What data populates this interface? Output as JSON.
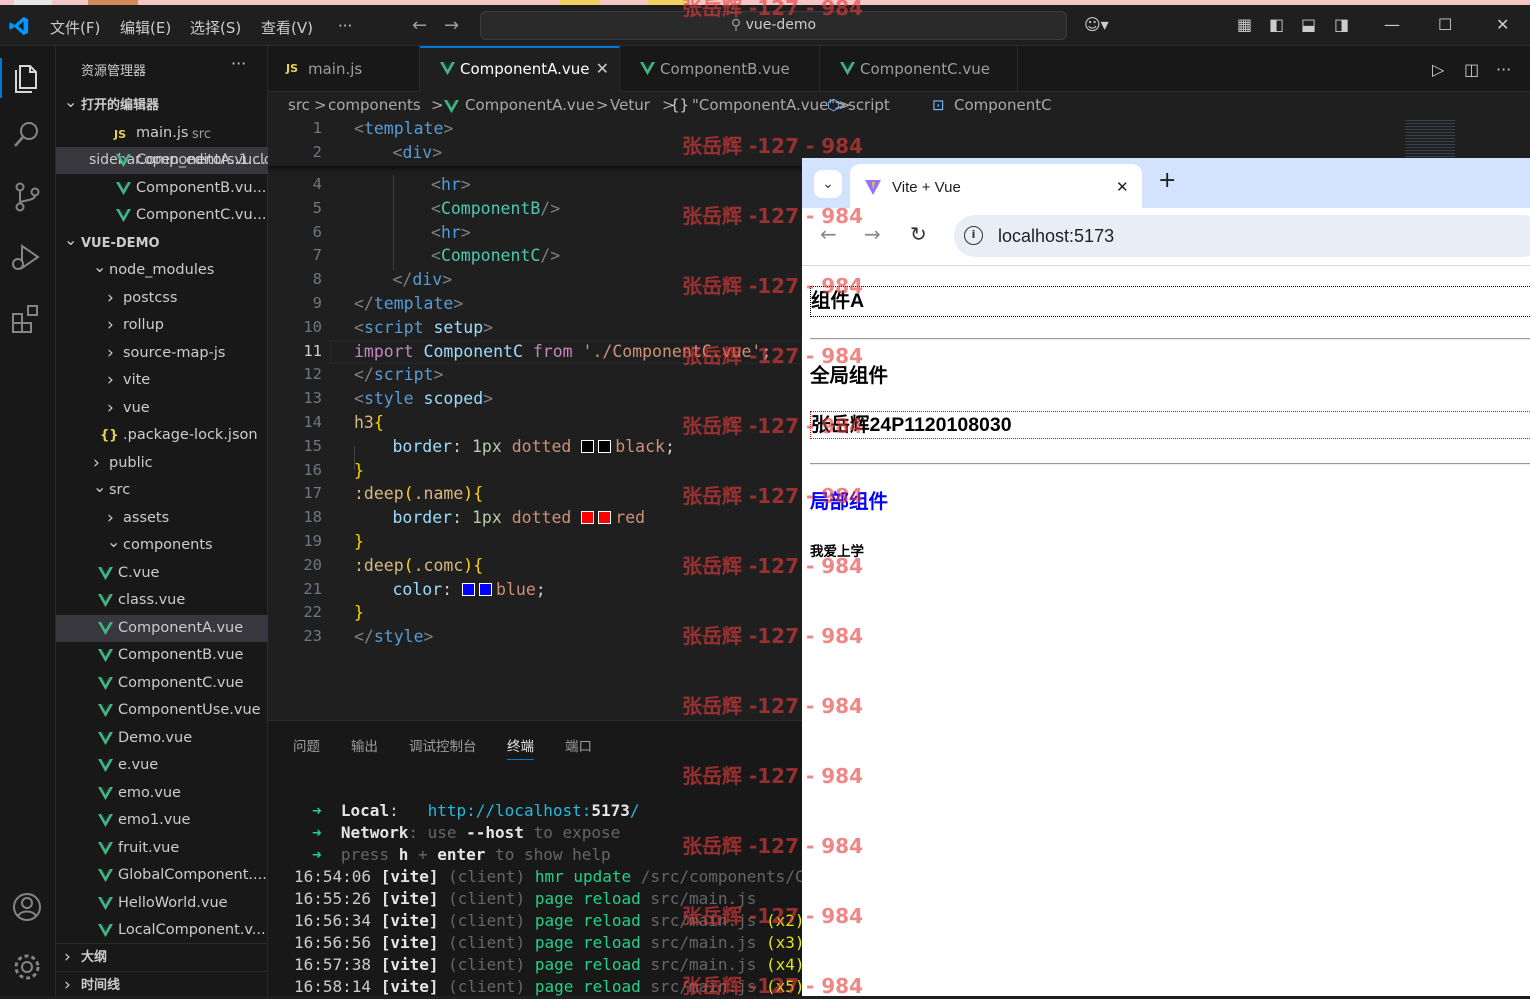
{
  "menu": [
    "文件(F)",
    "编辑(E)",
    "选择(S)",
    "查看(V)",
    "···"
  ],
  "search_text": "vue-demo",
  "sidebar": {
    "title": "资源管理器",
    "more": "···",
    "open_editors_header": "打开的编辑器",
    "open_editors": [
      {
        "name": "main.js",
        "hint": "src",
        "type": "js"
      },
      {
        "name": "ComponentA.vu...",
        "type": "vue",
        "selected": true,
        "close": "✕"
      },
      {
        "name": "ComponentB.vu...",
        "type": "vue"
      },
      {
        "name": "ComponentC.vu...",
        "type": "vue"
      }
    ],
    "project_header": "VUE-DEMO",
    "tree": [
      {
        "name": "node_modules",
        "kind": "folder-open",
        "depth": 1
      },
      {
        "name": "postcss",
        "kind": "folder",
        "depth": 2
      },
      {
        "name": "rollup",
        "kind": "folder",
        "depth": 2
      },
      {
        "name": "source-map-js",
        "kind": "folder",
        "depth": 2
      },
      {
        "name": "vite",
        "kind": "folder",
        "depth": 2
      },
      {
        "name": "vue",
        "kind": "folder",
        "depth": 2
      },
      {
        "name": ".package-lock.json",
        "kind": "json",
        "depth": 2
      },
      {
        "name": "public",
        "kind": "folder",
        "depth": 1
      },
      {
        "name": "src",
        "kind": "folder-open",
        "depth": 1
      },
      {
        "name": "assets",
        "kind": "folder",
        "depth": 2
      },
      {
        "name": "components",
        "kind": "folder-open",
        "depth": 2
      },
      {
        "name": "C.vue",
        "kind": "vue",
        "depth": 3
      },
      {
        "name": "class.vue",
        "kind": "vue",
        "depth": 3
      },
      {
        "name": "ComponentA.vue",
        "kind": "vue",
        "depth": 3,
        "selected": true
      },
      {
        "name": "ComponentB.vue",
        "kind": "vue",
        "depth": 3
      },
      {
        "name": "ComponentC.vue",
        "kind": "vue",
        "depth": 3
      },
      {
        "name": "ComponentUse.vue",
        "kind": "vue",
        "depth": 3
      },
      {
        "name": "Demo.vue",
        "kind": "vue",
        "depth": 3
      },
      {
        "name": "e.vue",
        "kind": "vue",
        "depth": 3
      },
      {
        "name": "emo.vue",
        "kind": "vue",
        "depth": 3
      },
      {
        "name": "emo1.vue",
        "kind": "vue",
        "depth": 3
      },
      {
        "name": "fruit.vue",
        "kind": "vue",
        "depth": 3
      },
      {
        "name": "GlobalComponent....",
        "kind": "vue",
        "depth": 3
      },
      {
        "name": "HelloWorld.vue",
        "kind": "vue",
        "depth": 3
      },
      {
        "name": "LocalComponent.v...",
        "kind": "vue",
        "depth": 3
      }
    ],
    "outline": "大纲",
    "timeline": "时间线"
  },
  "tabs": [
    {
      "name": "main.js",
      "type": "js"
    },
    {
      "name": "ComponentA.vue",
      "type": "vue",
      "active": true,
      "close": "✕"
    },
    {
      "name": "ComponentB.vue",
      "type": "vue"
    },
    {
      "name": "ComponentC.vue",
      "type": "vue"
    }
  ],
  "breadcrumbs": [
    "src",
    "components",
    "ComponentA.vue",
    "Vetur",
    "\"ComponentA.vue\"",
    "script",
    "ComponentC"
  ],
  "breadcrumb_sep": ">",
  "code_lines": [
    {
      "n": "1",
      "indent": 0,
      "seg": [
        [
          "t-br",
          "<"
        ],
        [
          "t-tag",
          "template"
        ],
        [
          "t-br",
          ">"
        ]
      ]
    },
    {
      "n": "2",
      "indent": 1,
      "seg": [
        [
          "t-br",
          "<"
        ],
        [
          "t-tag",
          "div"
        ],
        [
          "t-br",
          ">"
        ]
      ]
    },
    {
      "n": "4",
      "indent": 2,
      "seg": [
        [
          "t-br",
          "<"
        ],
        [
          "t-tag",
          "hr"
        ],
        [
          "t-br",
          ">"
        ]
      ]
    },
    {
      "n": "5",
      "indent": 2,
      "seg": [
        [
          "t-br",
          "<"
        ],
        [
          "t-cmp",
          "ComponentB"
        ],
        [
          "t-br",
          "/>"
        ]
      ]
    },
    {
      "n": "6",
      "indent": 2,
      "seg": [
        [
          "t-br",
          "<"
        ],
        [
          "t-tag",
          "hr"
        ],
        [
          "t-br",
          ">"
        ]
      ]
    },
    {
      "n": "7",
      "indent": 2,
      "seg": [
        [
          "t-br",
          "<"
        ],
        [
          "t-cmp",
          "ComponentC"
        ],
        [
          "t-br",
          "/>"
        ]
      ]
    },
    {
      "n": "8",
      "indent": 1,
      "seg": [
        [
          "t-br",
          "</"
        ],
        [
          "t-tag",
          "div"
        ],
        [
          "t-br",
          ">"
        ]
      ]
    },
    {
      "n": "9",
      "indent": 0,
      "seg": [
        [
          "t-br",
          "</"
        ],
        [
          "t-tag",
          "template"
        ],
        [
          "t-br",
          ">"
        ]
      ]
    },
    {
      "n": "10",
      "indent": 0,
      "seg": [
        [
          "t-br",
          "<"
        ],
        [
          "t-tag",
          "script"
        ],
        [
          "",
          "",
          " "
        ],
        [
          "t-attr",
          "setup"
        ],
        [
          "t-br",
          ">"
        ]
      ]
    },
    {
      "n": "11",
      "indent": 0,
      "cur": true,
      "seg": [
        [
          "t-kw",
          "import"
        ],
        [
          "",
          " "
        ],
        [
          "t-var",
          "ComponentC"
        ],
        [
          "",
          " "
        ],
        [
          "t-kw",
          "from"
        ],
        [
          "",
          " "
        ],
        [
          "t-str",
          "'./ComponentC.vue'"
        ],
        [
          "",
          ";"
        ]
      ]
    },
    {
      "n": "12",
      "indent": 0,
      "seg": [
        [
          "t-br",
          "</"
        ],
        [
          "t-tag",
          "script"
        ],
        [
          "t-br",
          ">"
        ]
      ]
    },
    {
      "n": "13",
      "indent": 0,
      "seg": [
        [
          "t-br",
          "<"
        ],
        [
          "t-tag",
          "style"
        ],
        [
          "",
          " "
        ],
        [
          "t-attr",
          "scoped"
        ],
        [
          "t-br",
          ">"
        ]
      ]
    },
    {
      "n": "14",
      "indent": 0,
      "seg": [
        [
          "t-sel",
          "h3"
        ],
        [
          "t-yel",
          "{"
        ]
      ]
    },
    {
      "n": "15",
      "indent": 1,
      "seg": [
        [
          "t-attr",
          "border"
        ],
        [
          "",
          ": "
        ],
        [
          "t-num",
          "1px"
        ],
        [
          "",
          " "
        ],
        [
          "t-str",
          "dotted"
        ],
        [
          "",
          "",
          " "
        ],
        [
          "sw",
          "#000000"
        ],
        [
          "sw",
          "#000000"
        ],
        [
          "t-str",
          "black"
        ],
        [
          "",
          ";"
        ]
      ]
    },
    {
      "n": "16",
      "indent": 0,
      "seg": [
        [
          "t-yel",
          "}"
        ]
      ]
    },
    {
      "n": "17",
      "indent": 0,
      "seg": [
        [
          "t-sel",
          ":deep"
        ],
        [
          "t-yel",
          "("
        ],
        [
          "t-sel",
          ".name"
        ],
        [
          "t-yel",
          ")"
        ],
        [
          "t-yel",
          "{"
        ]
      ]
    },
    {
      "n": "18",
      "indent": 1,
      "seg": [
        [
          "t-attr",
          "border"
        ],
        [
          "",
          ": "
        ],
        [
          "t-num",
          "1px"
        ],
        [
          "",
          " "
        ],
        [
          "t-str",
          "dotted"
        ],
        [
          "",
          " "
        ],
        [
          "sw",
          "#ff0000"
        ],
        [
          "sw",
          "#ff0000"
        ],
        [
          "t-str",
          "red"
        ]
      ]
    },
    {
      "n": "19",
      "indent": 0,
      "seg": [
        [
          "t-yel",
          "}"
        ]
      ]
    },
    {
      "n": "20",
      "indent": 0,
      "seg": [
        [
          "t-sel",
          ":deep"
        ],
        [
          "t-yel",
          "("
        ],
        [
          "t-sel",
          ".comc"
        ],
        [
          "t-yel",
          ")"
        ],
        [
          "t-yel",
          "{"
        ]
      ]
    },
    {
      "n": "21",
      "indent": 1,
      "seg": [
        [
          "t-attr",
          "color"
        ],
        [
          "",
          ": "
        ],
        [
          "sw",
          "#0000ff"
        ],
        [
          "sw",
          "#0000ff"
        ],
        [
          "t-str",
          "blue"
        ],
        [
          "",
          ";"
        ]
      ]
    },
    {
      "n": "22",
      "indent": 0,
      "seg": [
        [
          "t-yel",
          "}"
        ]
      ]
    },
    {
      "n": "23",
      "indent": 0,
      "seg": [
        [
          "t-br",
          "</"
        ],
        [
          "t-tag",
          "style"
        ],
        [
          "t-br",
          ">"
        ]
      ]
    }
  ],
  "panel": {
    "tabs": [
      "问题",
      "输出",
      "调试控制台",
      "终端",
      "端口"
    ],
    "active_tab": "终端",
    "terminal": [
      [
        [
          "g",
          "➜  "
        ],
        [
          "wb",
          "Local"
        ],
        [
          "",
          ":   "
        ],
        [
          "cy",
          "http://localhost:"
        ],
        [
          "cy wb",
          "5173"
        ],
        [
          "cy",
          "/"
        ]
      ],
      [
        [
          "g",
          "➜  "
        ],
        [
          "dim wb",
          "Network"
        ],
        [
          "dim",
          ": use "
        ],
        [
          "wb",
          "--host"
        ],
        [
          "dim",
          " to expose"
        ]
      ],
      [
        [
          "g",
          "➜  "
        ],
        [
          "dim",
          "press "
        ],
        [
          "wb",
          "h"
        ],
        [
          "dim",
          " + "
        ],
        [
          "wb",
          "enter"
        ],
        [
          "dim",
          " to show help"
        ]
      ],
      [
        [
          "",
          "16:54:06 "
        ],
        [
          "bl wb",
          "[vite]"
        ],
        [
          "dim",
          " (client) "
        ],
        [
          "g",
          "hmr update "
        ],
        [
          "dim",
          "/src/components/Compo"
        ]
      ],
      [
        [
          "",
          "16:55:26 "
        ],
        [
          "bl wb",
          "[vite]"
        ],
        [
          "dim",
          " (client) "
        ],
        [
          "g",
          "page reload "
        ],
        [
          "dim",
          "src/main.js"
        ]
      ],
      [
        [
          "",
          "16:56:34 "
        ],
        [
          "bl wb",
          "[vite]"
        ],
        [
          "dim",
          " (client) "
        ],
        [
          "g",
          "page reload "
        ],
        [
          "dim",
          "src/main.js "
        ],
        [
          "yl",
          "(x2)"
        ]
      ],
      [
        [
          "",
          "16:56:56 "
        ],
        [
          "bl wb",
          "[vite]"
        ],
        [
          "dim",
          " (client) "
        ],
        [
          "g",
          "page reload "
        ],
        [
          "dim",
          "src/main.js "
        ],
        [
          "yl",
          "(x3)"
        ]
      ],
      [
        [
          "",
          "16:57:38 "
        ],
        [
          "bl wb",
          "[vite]"
        ],
        [
          "dim",
          " (client) "
        ],
        [
          "g",
          "page reload "
        ],
        [
          "dim",
          "src/main.js "
        ],
        [
          "yl",
          "(x4)"
        ]
      ],
      [
        [
          "",
          "16:58:14 "
        ],
        [
          "bl wb",
          "[vite]"
        ],
        [
          "dim",
          " (client) "
        ],
        [
          "g",
          "page reload "
        ],
        [
          "dim",
          "src/main.js "
        ],
        [
          "yl",
          "(x5)"
        ]
      ]
    ]
  },
  "browser": {
    "tab_title": "Vite + Vue",
    "tab_close": "✕",
    "new_tab": "+",
    "url": "localhost:5173",
    "content": {
      "h1": "组件A",
      "h2": "全局组件",
      "h3": "张岳辉24P1120108030",
      "h4": "局部组件",
      "p": "我爱上学"
    }
  },
  "watermark": "张岳辉 -127 - 984",
  "colors": {
    "accent": "#0078d4",
    "vue_green": "#41b883",
    "editor_bg": "#1f1f1f",
    "sidebar_bg": "#181818",
    "selected": "#37373d"
  }
}
